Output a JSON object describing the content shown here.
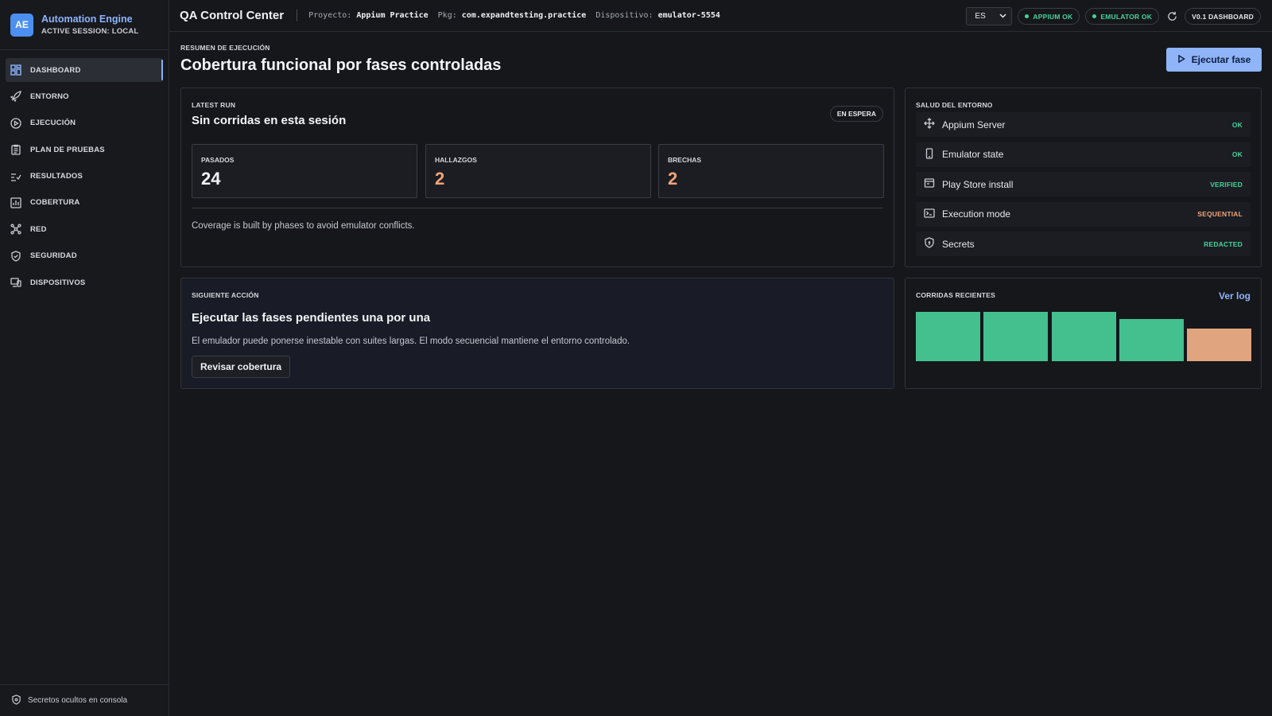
{
  "brand": {
    "logo": "AE",
    "title": "Automation Engine",
    "subtitle": "ACTIVE SESSION: LOCAL"
  },
  "sidebar": {
    "items": [
      {
        "label": "DASHBOARD",
        "icon": "grid-icon",
        "active": true
      },
      {
        "label": "ENTORNO",
        "icon": "rocket-icon"
      },
      {
        "label": "EJECUCIÓN",
        "icon": "play-circle-icon"
      },
      {
        "label": "PLAN DE PRUEBAS",
        "icon": "clipboard-icon"
      },
      {
        "label": "RESULTADOS",
        "icon": "checklist-icon"
      },
      {
        "label": "COBERTURA",
        "icon": "bar-chart-icon"
      },
      {
        "label": "RED",
        "icon": "network-icon"
      },
      {
        "label": "SEGURIDAD",
        "icon": "shield-check-icon"
      },
      {
        "label": "DISPOSITIVOS",
        "icon": "devices-icon"
      }
    ],
    "footer": "Secretos ocultos en consola"
  },
  "topbar": {
    "title": "QA Control Center",
    "project_label": "Proyecto:",
    "project_value": "Appium Practice",
    "pkg_label": "Pkg:",
    "pkg_value": "com.expandtesting.practice",
    "device_label": "Dispositivo:",
    "device_value": "emulator-5554",
    "language": "ES",
    "appium_status": "APPIUM OK",
    "emulator_status": "EMULATOR OK",
    "version": "V0.1 DASHBOARD"
  },
  "page": {
    "eyebrow": "RESUMEN DE EJECUCIÓN",
    "title": "Cobertura funcional por fases controladas",
    "run_button": "Ejecutar fase"
  },
  "latest_run": {
    "eyebrow": "LATEST RUN",
    "title": "Sin corridas en esta sesión",
    "badge": "EN ESPERA",
    "metrics": [
      {
        "label": "PASADOS",
        "value": "24",
        "color": "#f2f4f7"
      },
      {
        "label": "HALLAZGOS",
        "value": "2",
        "color": "#f0a47a"
      },
      {
        "label": "BRECHAS",
        "value": "2",
        "color": "#f0a47a"
      }
    ],
    "note": "Coverage is built by phases to avoid emulator conflicts."
  },
  "health": {
    "eyebrow": "SALUD DEL ENTORNO",
    "rows": [
      {
        "label": "Appium Server",
        "status": "OK",
        "status_color": "#44d39a",
        "icon": "move-arrows-icon"
      },
      {
        "label": "Emulator state",
        "status": "OK",
        "status_color": "#44d39a",
        "icon": "phone-icon"
      },
      {
        "label": "Play Store install",
        "status": "VERIFIED",
        "status_color": "#44d39a",
        "icon": "store-icon"
      },
      {
        "label": "Execution mode",
        "status": "SEQUENTIAL",
        "status_color": "#f0a47a",
        "icon": "terminal-icon"
      },
      {
        "label": "Secrets",
        "status": "REDACTED",
        "status_color": "#44d39a",
        "icon": "shield-lock-icon"
      }
    ]
  },
  "next_action": {
    "eyebrow": "SIGUIENTE ACCIÓN",
    "title": "Ejecutar las fases pendientes una por una",
    "description": "El emulador puede ponerse inestable con suites largas. El modo secuencial mantiene el entorno controlado.",
    "button": "Revisar cobertura"
  },
  "recent_runs": {
    "eyebrow": "CORRIDAS RECIENTES",
    "link": "Ver log",
    "bars": [
      {
        "level": 1.0,
        "color": "#43c08e"
      },
      {
        "level": 1.0,
        "color": "#43c08e"
      },
      {
        "level": 1.0,
        "color": "#43c08e"
      },
      {
        "level": 0.85,
        "color": "#43c08e"
      },
      {
        "level": 0.66,
        "color": "#e0a47e"
      }
    ]
  },
  "colors": {
    "accent": "#8fb4f8",
    "ok": "#44d39a",
    "warn": "#f0a47a",
    "brand": "#4c8ff0"
  }
}
